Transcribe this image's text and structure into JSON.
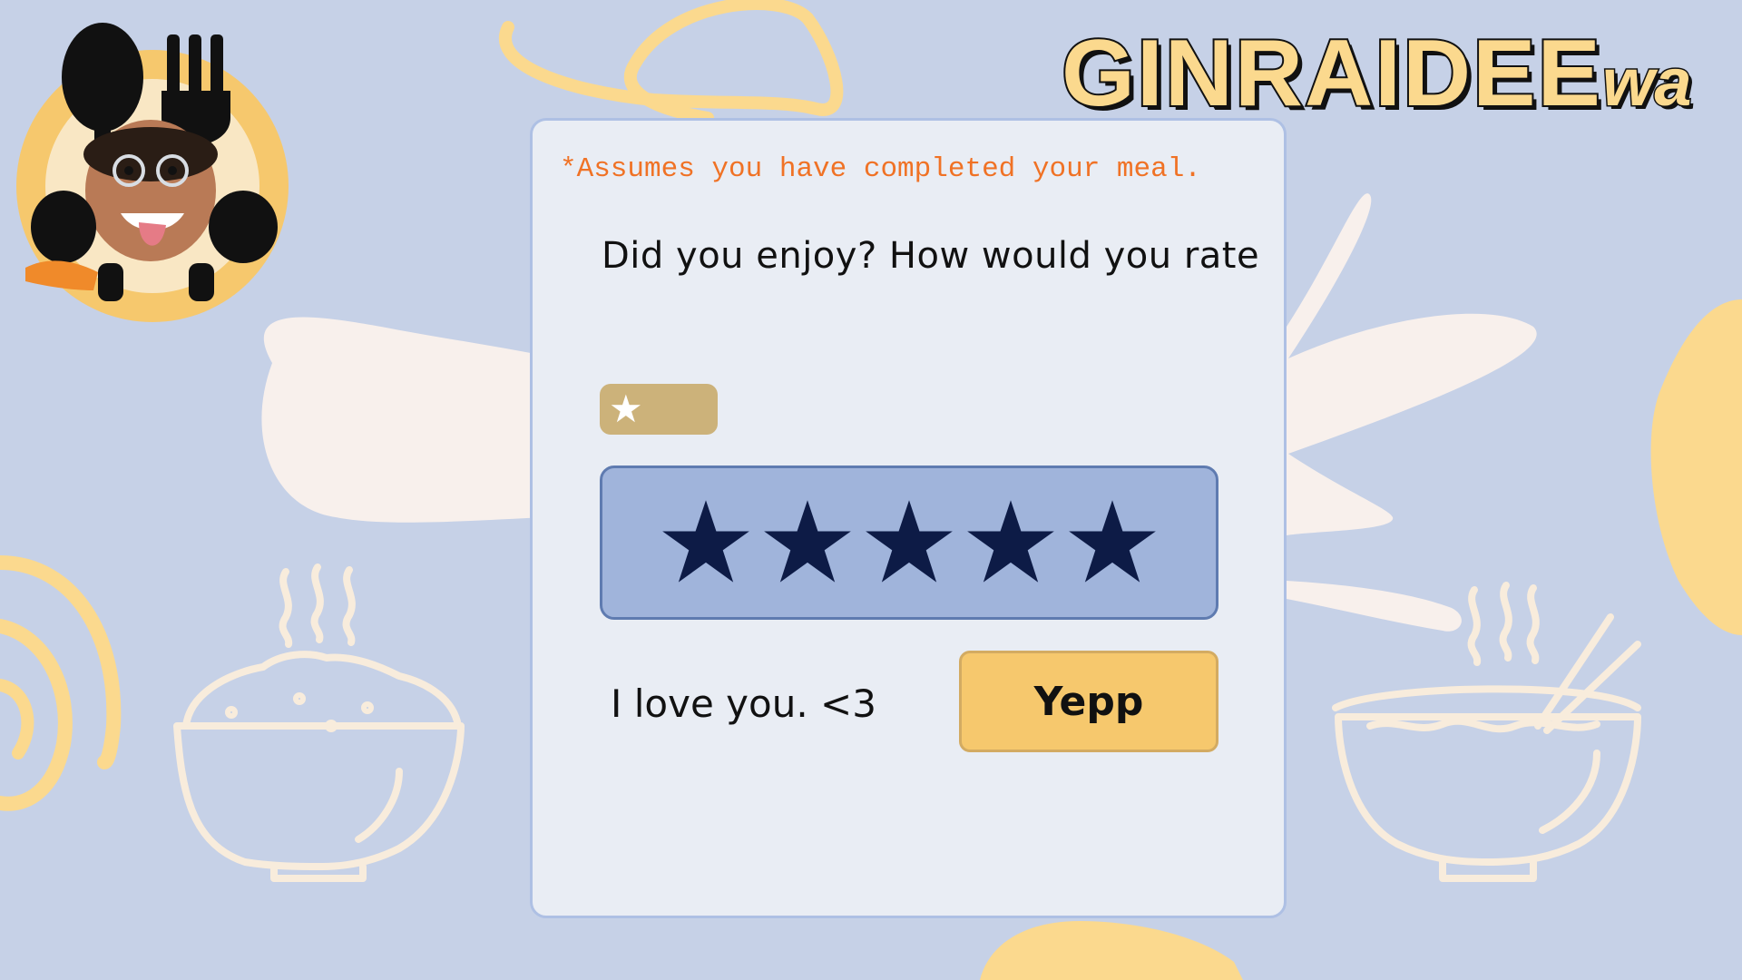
{
  "app": {
    "title_main": "GINRAIDEE",
    "title_suffix": "wa"
  },
  "rating_card": {
    "note": "*Assumes you have completed your meal.",
    "question": "Did you enjoy? How would you rate",
    "current_rating": 1,
    "max_rating": 5,
    "star_count": 5,
    "message": "I love you. <3",
    "confirm_label": "Yepp"
  },
  "icons": {
    "logo": "avatar-with-spoon-fork-logo",
    "rating_badge": "star-icon",
    "rating_stars": "star-icon",
    "decor_left": "rice-bowl-icon",
    "decor_right": "noodle-bowl-icon"
  },
  "colors": {
    "background": "#c6d1e7",
    "card": "#e9edf4",
    "note_orange": "#f07225",
    "star_navy": "#0d1b46",
    "stars_box": "#a0b4db",
    "badge": "#ccb27a",
    "button": "#f6c86d",
    "accent_yellow": "#fbd98e",
    "blob_cream": "#f8f0ec"
  }
}
